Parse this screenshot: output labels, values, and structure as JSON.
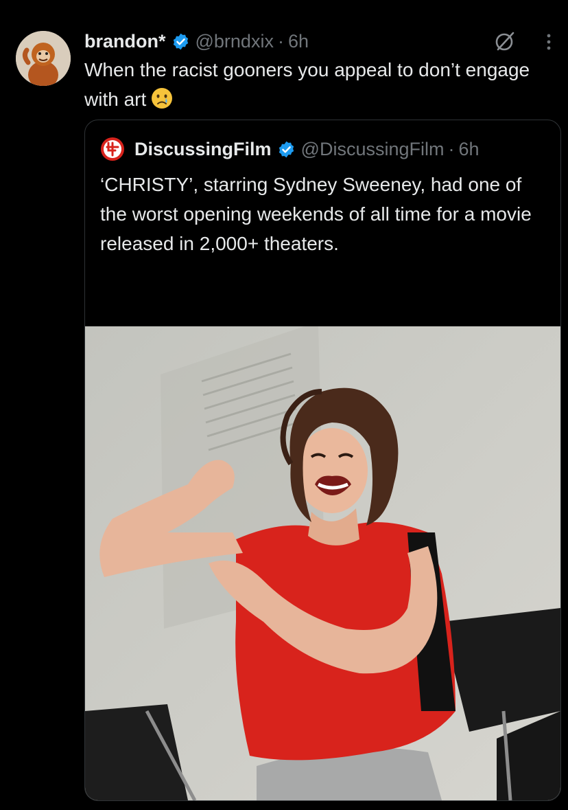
{
  "tweet": {
    "author": {
      "display_name": "brandon*",
      "handle": "@brndxix",
      "time": "6h",
      "avatar_icon": "orangutan-avatar"
    },
    "text": "When the racist gooners you appeal to don’t engage with art",
    "emoji": "crying-face-emoji",
    "separator": "·",
    "icons": [
      "verified-badge-icon",
      "grok-icon",
      "more-options-icon"
    ]
  },
  "quote": {
    "author": {
      "display_name": "DiscussingFilm",
      "handle": "@DiscussingFilm",
      "time": "6h",
      "logo_icon": "discussingfilm-logo"
    },
    "text": "‘CHRISTY’, starring Sydney Sweeney, had one of the worst opening weekends of all time for a movie released in 2,000+ theaters.",
    "ellipsis": "...",
    "media": {
      "type": "photo",
      "description_icon": "woman-flexing-photo"
    }
  },
  "colors": {
    "background": "#000000",
    "text_primary": "#e7e9ea",
    "text_secondary": "#71767b",
    "border": "#2f3336",
    "verified_blue": "#1d9bf0",
    "shirt_red": "#d8231c"
  }
}
